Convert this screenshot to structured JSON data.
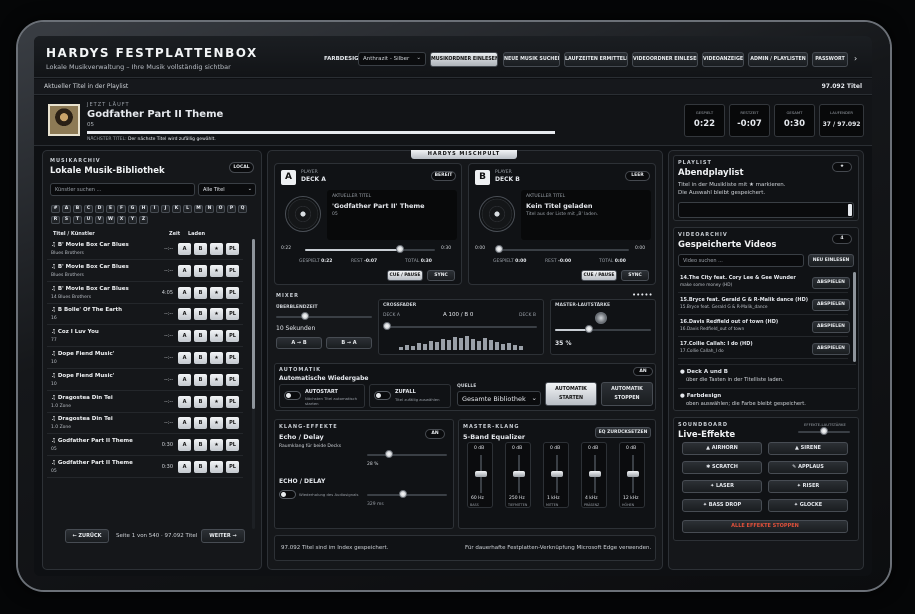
{
  "header": {
    "title": "HARDYS FESTPLATTENBOX",
    "subtitle": "Lokale Musikverwaltung – Ihre Musik vollständig sichtbar",
    "farbdesign_label": "FARBDESIGN",
    "farbdesign_value": "Anthrazit - Silber",
    "nav": [
      "MUSIKORDNER EINLESEN",
      "NEUE MUSIK SUCHEN",
      "LAUFZEITEN ERMITTELN",
      "VIDEOORDNER EINLESEN",
      "VIDEOANZEIGE",
      "ADMIN / PLAYLISTEN",
      "PASSWORT"
    ],
    "more": "›"
  },
  "status_bar": {
    "left": "Aktueller Titel in der Playlist",
    "right": "97.092 Titel"
  },
  "now_playing": {
    "label": "JETZT LÄUFT",
    "title": "Godfather Part II Theme",
    "sub": "05",
    "progress": 1.0,
    "next_label": "NÄCHSTER TITEL:",
    "next_value": "Der nächste Titel wird zufällig gewählt.",
    "stats": [
      {
        "k": "GESPIELT",
        "v": "0:22"
      },
      {
        "k": "RESTZEIT",
        "v": "-0:07"
      },
      {
        "k": "GESAMT",
        "v": "0:30"
      },
      {
        "k": "LAUFENDER",
        "v": "37 / 97.092"
      }
    ]
  },
  "library": {
    "label": "MUSIKARCHIV",
    "title": "Lokale Musik-Bibliothek",
    "badge": "LOCAL",
    "search_placeholder": "Künstler suchen ...",
    "filter": "Alle Titel",
    "letters": [
      "#",
      "A",
      "B",
      "C",
      "D",
      "E",
      "F",
      "G",
      "H",
      "I",
      "J",
      "K",
      "L",
      "M",
      "N",
      "O",
      "P",
      "Q",
      "R",
      "S",
      "T",
      "U",
      "V",
      "W",
      "X",
      "Y",
      "Z"
    ],
    "col_title": "Titel / Künstler",
    "col_time": "Zeit",
    "col_load": "Laden",
    "load_buttons": [
      "A",
      "B",
      "★",
      "PL"
    ],
    "rows": [
      {
        "t": "♫ B' Movie Box Car Blues",
        "a": "Blues Brothers",
        "tm": "--:--"
      },
      {
        "t": "♫ B' Movie Box Car Blues",
        "a": "Blues Brothers",
        "tm": "--:--"
      },
      {
        "t": "♫ B' Movie Box Car Blues",
        "a": "14 Blues Brothers",
        "tm": "4:05"
      },
      {
        "t": "♫ B Bolle' Of The Earth",
        "a": "16",
        "tm": "--:--"
      },
      {
        "t": "♫ Coz I Luv You",
        "a": "77",
        "tm": "--:--"
      },
      {
        "t": "♫ Dope Fiend Music'",
        "a": "10",
        "tm": "--:--"
      },
      {
        "t": "♫ Dope Fiend Music'",
        "a": "10",
        "tm": "--:--"
      },
      {
        "t": "♫ Dragostea Din Tei",
        "a": "1.0 Zone",
        "tm": "--:--"
      },
      {
        "t": "♫ Dragostea Din Tei",
        "a": "1.0 Zone",
        "tm": "--:--"
      },
      {
        "t": "♫ Godfather Part II Theme",
        "a": "05",
        "tm": "0:30"
      },
      {
        "t": "♫ Godfather Part II Theme",
        "a": "05",
        "tm": "0:30"
      }
    ],
    "prev": "← ZURÜCK",
    "page_info": "Seite 1 von 540 · 97.092 Titel",
    "next": "WEITER →"
  },
  "mixer_panel": {
    "title": "HARDYS MISCHPULT",
    "deck_a": {
      "letter": "A",
      "small": "PLAYER",
      "name": "DECK A",
      "state": "BEREIT",
      "track_label": "AKTUELLER TITEL",
      "track": "'Godfather Part II' Theme",
      "sub": "05",
      "elapsed": "0:22",
      "total": "0:30",
      "position": 0.73,
      "played_label": "GESPIELT",
      "played": "0:22",
      "rest_label": "REST",
      "rest": "-0:07",
      "total_label": "TOTAL",
      "total2": "0:30",
      "cue": "CUE / PAUSE",
      "sync": "SYNC"
    },
    "deck_b": {
      "letter": "B",
      "small": "PLAYER",
      "name": "DECK B",
      "state": "LEER",
      "track_label": "AKTUELLER TITEL",
      "track": "Kein Titel geladen",
      "sub": "Titel aus der Liste mit „B' laden.",
      "elapsed": "0:00",
      "total": "0:00",
      "position": 0.0,
      "played_label": "GESPIELT",
      "played": "0:00",
      "rest_label": "REST",
      "rest": "-0:00",
      "total_label": "TOTAL",
      "total2": "0:00",
      "cue": "CUE / PAUSE",
      "sync": "SYNC"
    },
    "mixer": {
      "label": "MIXER",
      "fade_label": "ÜBERBLENDZEIT",
      "fade_value": "10 Sekunden",
      "fade_level": 0.3,
      "ab": "A → B",
      "ba": "B → A",
      "cross_label": "CROSSFADER",
      "deck_a": "DECK A",
      "cross_value": "A 100 / B 0",
      "deck_b": "DECK B",
      "cross_level": 0.0,
      "master_label": "MASTER-LAUTSTÄRKE",
      "master_value": "35 %",
      "master_level": 0.35
    },
    "auto": {
      "label": "AUTOMATIK",
      "title": "Automatische Wiedergabe",
      "badge": "AN",
      "autostart": "AUTOSTART",
      "autostart_sub": "Nächsten Titel automatisch starten",
      "random": "ZUFALL",
      "random_sub": "Titel zufällig auswählen",
      "source_label": "QUELLE",
      "source_value": "Gesamte Bibliothek",
      "start": "AUTOMATIK STARTEN",
      "stop": "AUTOMATIK STOPPEN"
    },
    "effects": {
      "label": "KLANG-EFFEKTE",
      "title": "Echo / Delay",
      "badge": "AN",
      "desc": "Raumklang für beide Decks",
      "level_value": "28 %",
      "level": 0.28,
      "echo": "ECHO / DELAY",
      "echo_sub": "Wiederholung des Audiosignals",
      "ms_value": "329 ms",
      "ms_level": 0.45
    },
    "eq": {
      "label": "MASTER-KLANG",
      "title": "5-Band Equalizer",
      "reset": "EQ ZURÜCKSETZEN",
      "bands": [
        {
          "db": "0 dB",
          "f": "60 Hz",
          "n": "BASS",
          "level": 0.5
        },
        {
          "db": "0 dB",
          "f": "250 Hz",
          "n": "TIEFMITTEN",
          "level": 0.5
        },
        {
          "db": "0 dB",
          "f": "1 kHz",
          "n": "MITTEN",
          "level": 0.5
        },
        {
          "db": "0 dB",
          "f": "4 kHz",
          "n": "PRÄSENZ",
          "level": 0.5
        },
        {
          "db": "0 dB",
          "f": "12 kHz",
          "n": "HÖHEN",
          "level": 0.5
        }
      ]
    },
    "footer_left": "97.092 Titel sind im Index gespeichert.",
    "footer_right": "Für dauerhafte Festplatten-Verknüpfung Microsoft Edge verwenden."
  },
  "playlist": {
    "label": "PLAYLIST",
    "title": "Abendplaylist",
    "star": "★",
    "text1": "Titel in der Musikliste mit ★ markieren.",
    "text2": "Die Auswahl bleibt gespeichert."
  },
  "videos": {
    "label": "VIDEOARCHIV",
    "title": "Gespeicherte Videos",
    "count": "4",
    "search_placeholder": "Video suchen ...",
    "reload": "NEU EINLESEN",
    "play": "ABSPIELEN",
    "rows": [
      {
        "t": "14.The City feat. Cory Lee & Gee Wunder",
        "a": "make some money (HD)"
      },
      {
        "t": "15.Bryce feat. Gerald G & R-Malik dance (HD)",
        "a": "15.Bryce feat. Gerald G & R-Malik_dance"
      },
      {
        "t": "16.Davis Redfield out of town (HD)",
        "a": "16.Davis Redfield_out of town"
      },
      {
        "t": "17.Collie Callah: I do (HD)",
        "a": "17.Collie Callah_I do"
      }
    ],
    "info1_title": "Deck A und B",
    "info1_text": "über die Tasten in der Titelliste laden.",
    "info2_title": "Farbdesign",
    "info2_text": "oben auswählen; die Farbe bleibt gespeichert."
  },
  "soundboard": {
    "label": "SOUNDBOARD",
    "title": "Live-Effekte",
    "volume_label": "EFFEKTE-LAUTSTÄRKE",
    "volume_level": 0.5,
    "buttons": [
      "▲ AIRHORN",
      "▲ SIRENE",
      "✱ SCRATCH",
      "✎ APPLAUS",
      "✦ LASER",
      "✦ RISER",
      "✦ BASS DROP",
      "✦ GLOCKE"
    ],
    "stop": "ALLE EFFEKTE STOPPEN",
    "stop_color": "#e0503a"
  }
}
